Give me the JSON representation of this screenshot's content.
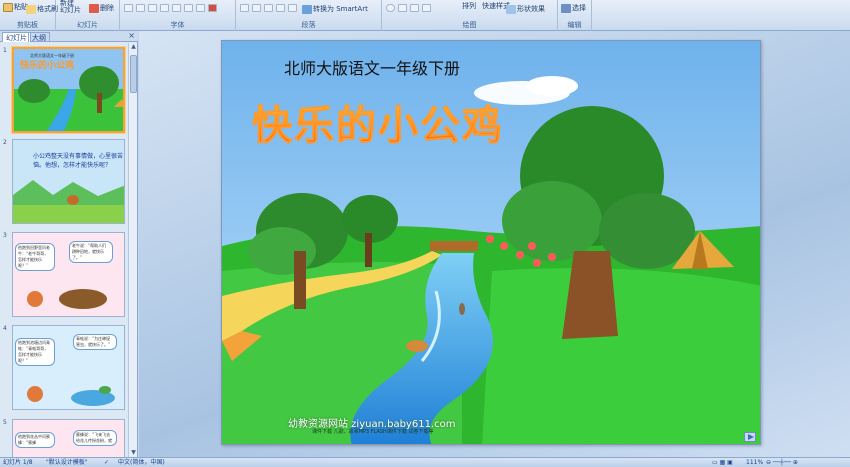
{
  "ribbon": {
    "clipboard": {
      "paste": "粘贴",
      "format_painter": "格式刷",
      "label": "剪贴板"
    },
    "slides": {
      "new_slide": "新建\n幻灯片",
      "delete": "删除",
      "label": "幻灯片"
    },
    "font": {
      "label": "字体"
    },
    "paragraph": {
      "convert_smartart": "转换为 SmartArt",
      "label": "段落"
    },
    "drawing": {
      "arrange": "排列",
      "quick_styles": "快速样式",
      "shape_effects": "形状效果",
      "label": "绘图"
    },
    "editing": {
      "select": "选择",
      "label": "编辑"
    }
  },
  "panel": {
    "tab_slides": "幻灯片",
    "tab_outline": "大纲",
    "close": "×",
    "slides": [
      {
        "num": "1",
        "title": "快乐的小公鸡",
        "header": "北师大版语文一年级下册"
      },
      {
        "num": "2",
        "text": "小公鸡整天没有事情做，心里很苦恼。他想，怎样才能快乐呢？"
      },
      {
        "num": "3",
        "bubble_left": "他跑到田野里问老牛：“老牛哥哥，怎样才能快乐呢？”",
        "bubble_right": "老牛说：“帮助人们耕种田地，就快乐了。”"
      },
      {
        "num": "4",
        "bubble_left": "他跑到池塘边问青蛙：“青蛙哥哥，怎样才能快乐呢？”",
        "bubble_right": "青蛙说：“为庄稼捉害虫，就快乐了。”"
      },
      {
        "num": "5",
        "bubble_left": "他跑到花丛中问蜜蜂：“蜜蜂",
        "bubble_right": "蜜蜂说：“飞来飞去给花儿传授花粉，就"
      }
    ]
  },
  "slide": {
    "subtitle": "北师大版语文一年级下册",
    "title": "快乐的小公鸡",
    "footer_site": "幼教资源网站  ziyuan.baby611.com",
    "footer_small": "课件下载   儿歌、故事MP3   FLASH课件下载   试卷下载等"
  },
  "status": {
    "slide_info": "幻灯片 1/8",
    "theme": "\"默认设计模板\"",
    "language": "中文(简体，中国)",
    "zoom": "111%"
  },
  "colors": {
    "ribbon": "#dbe6f4",
    "panel": "#dde8f5",
    "sky": "#8fc3f0",
    "grass": "#3bc23b",
    "title_orange": "#ff8d1f"
  }
}
